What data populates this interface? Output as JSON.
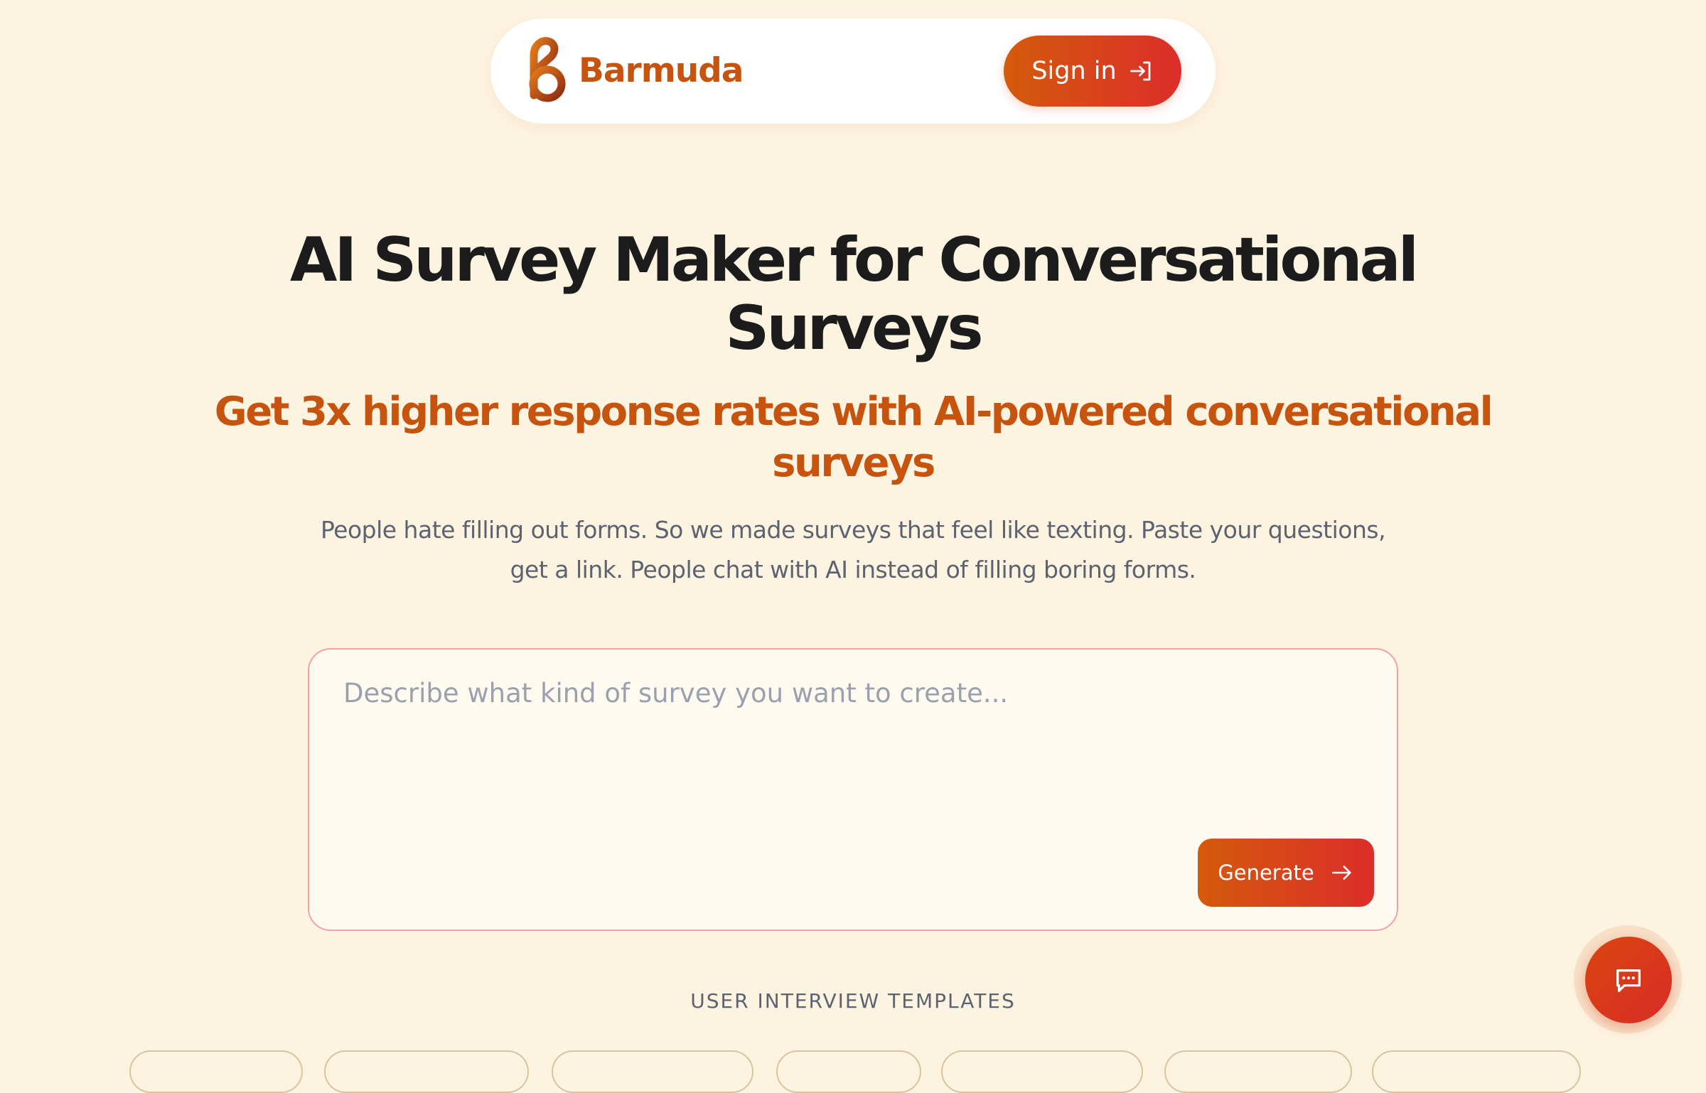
{
  "colors": {
    "page_background": "#fdf3e1",
    "brand": "#c6540e",
    "gradient_start": "#d45a0c",
    "gradient_end": "#dc2d2b",
    "text_dark": "#1c1c1c",
    "text_muted": "#5d6270",
    "placeholder": "#9aa1ad",
    "prompt_border": "#f0a3a5"
  },
  "navbar": {
    "logo_icon": "barmuda-b-logo-icon",
    "brand_name": "Barmuda",
    "signin_label": "Sign in",
    "signin_icon": "log-in-arrow-icon"
  },
  "hero": {
    "title": "AI Survey Maker for Conversational Surveys",
    "subtitle": "Get 3x higher response rates with AI-powered conversational surveys",
    "description": "People hate filling out forms. So we made surveys that feel like texting. Paste your questions, get a link. People chat with AI instead of filling boring forms."
  },
  "prompt": {
    "placeholder": "Describe what kind of survey you want to create...",
    "value": "",
    "generate_label": "Generate",
    "generate_icon": "arrow-right-icon"
  },
  "templates": {
    "heading": "USER INTERVIEW TEMPLATES",
    "chips": [
      {
        "label": ""
      },
      {
        "label": ""
      },
      {
        "label": ""
      },
      {
        "label": ""
      },
      {
        "label": ""
      },
      {
        "label": ""
      },
      {
        "label": ""
      }
    ]
  },
  "chat_widget": {
    "icon": "chat-bubble-icon"
  }
}
